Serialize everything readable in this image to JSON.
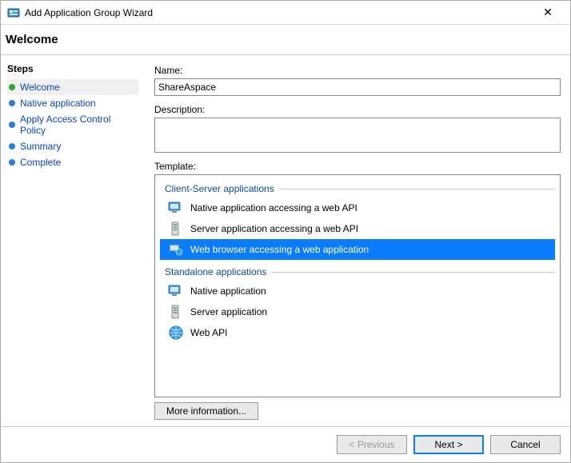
{
  "window": {
    "title": "Add Application Group Wizard"
  },
  "header": "Welcome",
  "sidebar": {
    "heading": "Steps",
    "items": [
      {
        "label": "Welcome"
      },
      {
        "label": "Native application"
      },
      {
        "label": "Apply Access Control Policy"
      },
      {
        "label": "Summary"
      },
      {
        "label": "Complete"
      }
    ]
  },
  "form": {
    "name_label": "Name:",
    "name_value": "ShareAspace",
    "description_label": "Description:",
    "description_value": "",
    "template_label": "Template:",
    "groups": [
      {
        "title": "Client-Server applications",
        "items": [
          {
            "label": "Native application accessing a web API",
            "selected": false
          },
          {
            "label": "Server application accessing a web API",
            "selected": false
          },
          {
            "label": "Web browser accessing a web application",
            "selected": true
          }
        ]
      },
      {
        "title": "Standalone applications",
        "items": [
          {
            "label": "Native application",
            "selected": false
          },
          {
            "label": "Server application",
            "selected": false
          },
          {
            "label": "Web API",
            "selected": false
          }
        ]
      }
    ],
    "more_info": "More information..."
  },
  "footer": {
    "previous": "< Previous",
    "next": "Next >",
    "cancel": "Cancel"
  }
}
